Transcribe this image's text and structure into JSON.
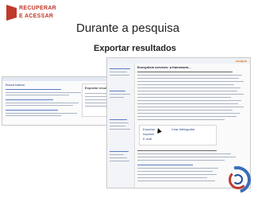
{
  "logo": {
    "line1": "RECUPERAR",
    "line2": "E ACESSAR"
  },
  "slide": {
    "title": "Durante a pesquisa",
    "subtitle": "Exportar resultados"
  },
  "screenshot_left": {
    "header": "Busca básica",
    "panel_title": "Exportar resultados"
  },
  "screenshot_right": {
    "brand": "scopus",
    "record_title": "Ecosystem services: a framework...",
    "links": [
      "Exportar",
      "Imprimir",
      "E-mail",
      "Criar bibliografia"
    ]
  }
}
